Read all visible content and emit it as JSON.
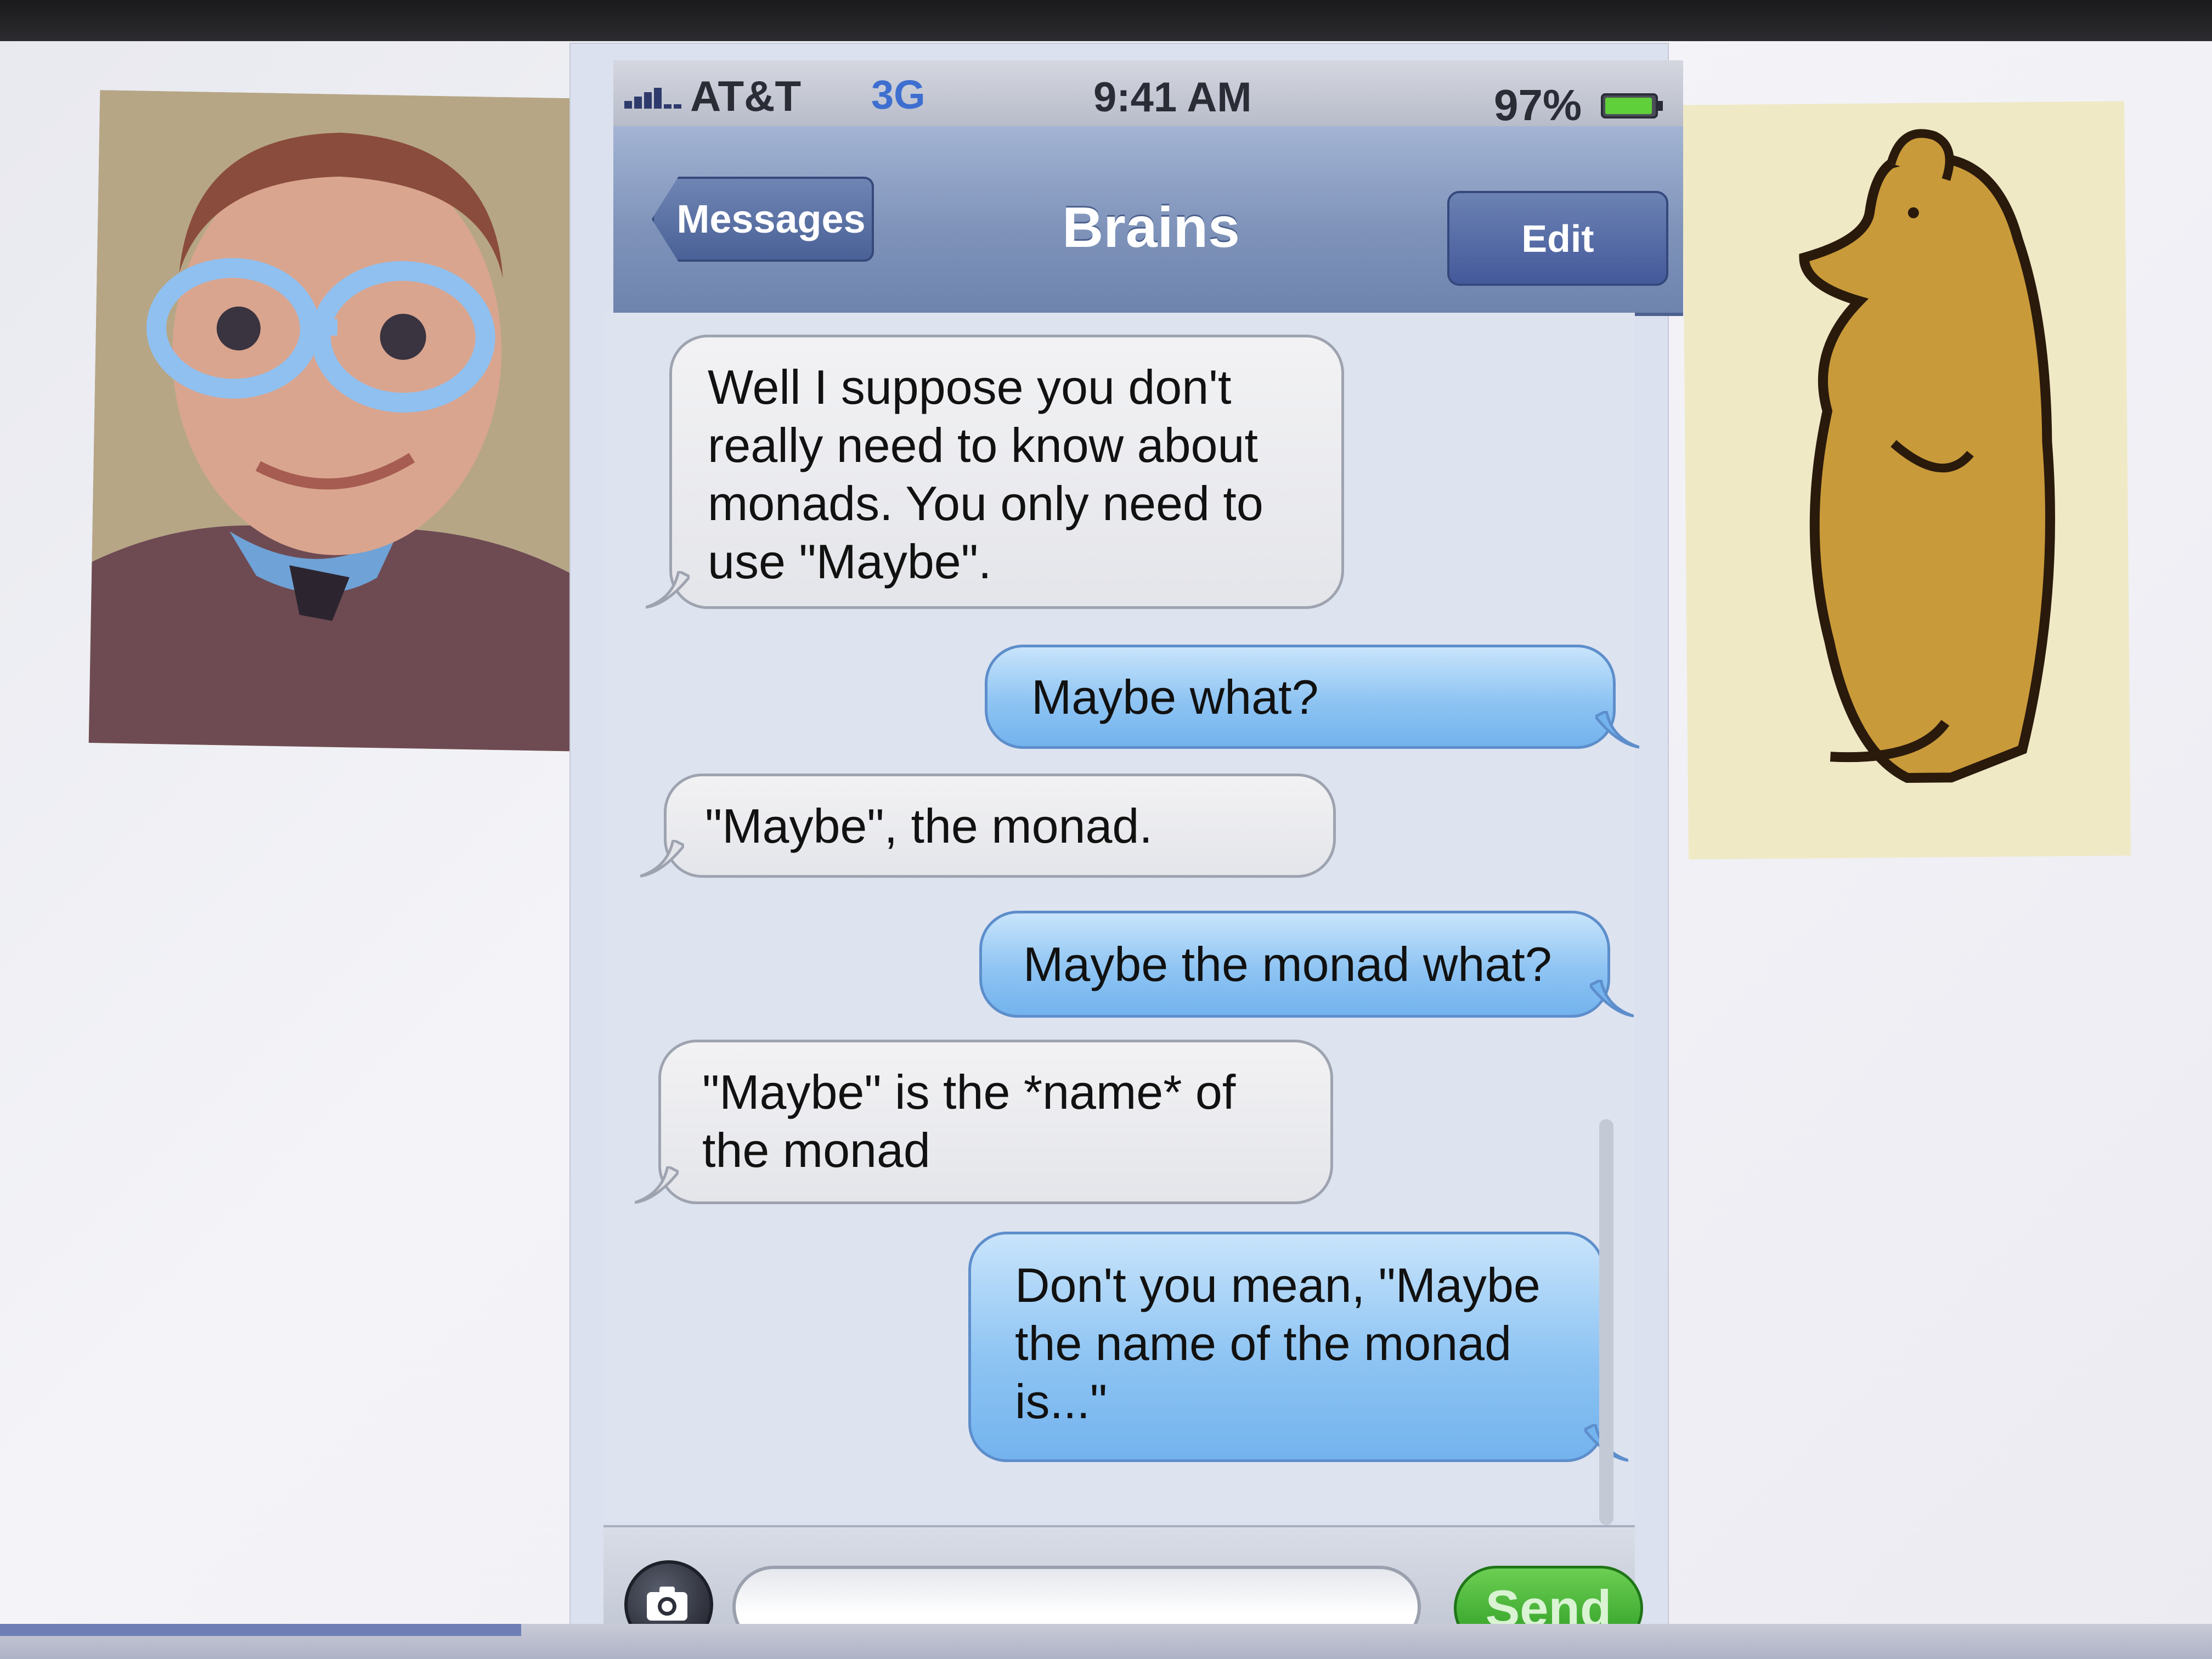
{
  "status_bar": {
    "carrier": "AT&T",
    "network": "3G",
    "time": "9:41 AM",
    "battery": "97%",
    "battery_level": 0.97
  },
  "nav": {
    "back_label": "Messages",
    "title": "Brains",
    "edit_label": "Edit"
  },
  "messages": [
    {
      "direction": "received",
      "text": "Well I suppose you don't really need to know about monads. You only need to use \"Maybe\"."
    },
    {
      "direction": "sent",
      "text": "Maybe what?"
    },
    {
      "direction": "received",
      "text": "\"Maybe\", the monad."
    },
    {
      "direction": "sent",
      "text": "Maybe the monad what?"
    },
    {
      "direction": "received",
      "text": "\"Maybe\" is the *name* of the monad"
    },
    {
      "direction": "sent",
      "text": "Don't you mean, \"Maybe the name of the monad is...\""
    }
  ],
  "composer": {
    "input_value": "",
    "send_label": "Send"
  },
  "colors": {
    "nav_bar": "#7f93ba",
    "sent_bubble": "#8ec4f3",
    "received_bubble": "#e4e5ea",
    "send_button": "#2b9b22",
    "network_label": "#3e6fd0"
  },
  "icons": {
    "signal": "signal-bars-icon",
    "battery": "battery-icon",
    "camera": "camera-icon"
  }
}
